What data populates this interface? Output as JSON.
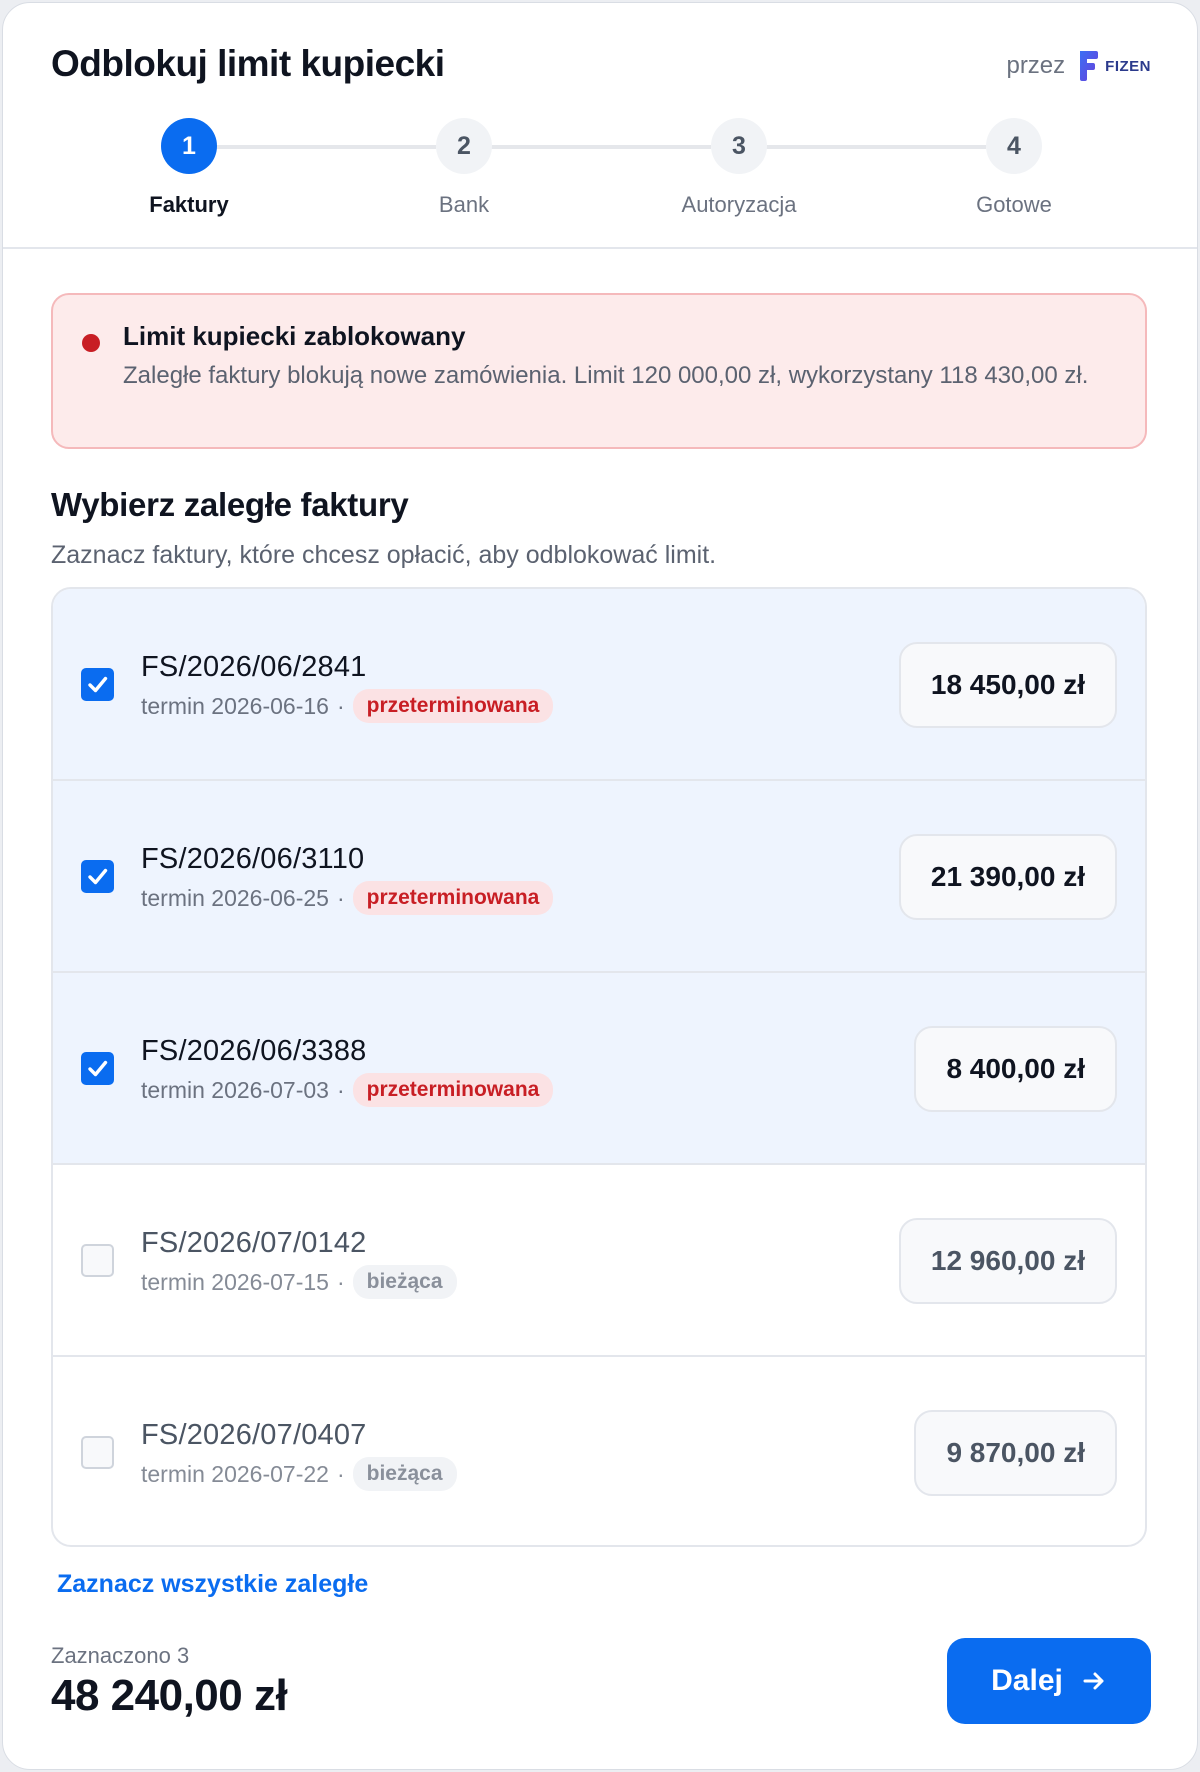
{
  "header": {
    "title": "Odblokuj limit kupiecki",
    "by_label": "przez",
    "brand_name": "FIZEN"
  },
  "steps": [
    {
      "number": "1",
      "label": "Faktury",
      "active": true
    },
    {
      "number": "2",
      "label": "Bank",
      "active": false
    },
    {
      "number": "3",
      "label": "Autoryzacja",
      "active": false
    },
    {
      "number": "4",
      "label": "Gotowe",
      "active": false
    }
  ],
  "alert": {
    "title": "Limit kupiecki zablokowany",
    "text": "Zaległe faktury blokują nowe zamówienia. Limit 120 000,00 zł, wykorzystany 118 430,00 zł."
  },
  "section": {
    "title": "Wybierz zaległe faktury",
    "subtitle": "Zaznacz faktury, które chcesz opłacić, aby odblokować limit."
  },
  "invoices": [
    {
      "number": "FS/2026/06/2841",
      "due": "termin 2026-06-16",
      "sep": "·",
      "status": "przeterminowana",
      "amount": "18 450,00 zł",
      "checked": true
    },
    {
      "number": "FS/2026/06/3110",
      "due": "termin 2026-06-25",
      "sep": "·",
      "status": "przeterminowana",
      "amount": "21 390,00 zł",
      "checked": true
    },
    {
      "number": "FS/2026/06/3388",
      "due": "termin 2026-07-03",
      "sep": "·",
      "status": "przeterminowana",
      "amount": "8 400,00 zł",
      "checked": true
    },
    {
      "number": "FS/2026/07/0142",
      "due": "termin 2026-07-15",
      "sep": "·",
      "status": "bieżąca",
      "amount": "12 960,00 zł",
      "checked": false
    },
    {
      "number": "FS/2026/07/0407",
      "due": "termin 2026-07-22",
      "sep": "·",
      "status": "bieżąca",
      "amount": "9 870,00 zł",
      "checked": false
    }
  ],
  "select_all_label": "Zaznacz wszystkie zaległe",
  "footer": {
    "selected_label": "Zaznaczono 3",
    "total": "48 240,00 zł",
    "next_label": "Dalej"
  },
  "colors": {
    "accent": "#0a6cf0",
    "danger": "#c81e24",
    "alert_bg": "#fdebeb",
    "selected_row_bg": "#eef4fe"
  },
  "icons": [
    "fizen-logo-icon",
    "alert-dot-icon",
    "checkbox-checked-icon",
    "checkbox-empty-icon",
    "arrow-right-icon"
  ]
}
